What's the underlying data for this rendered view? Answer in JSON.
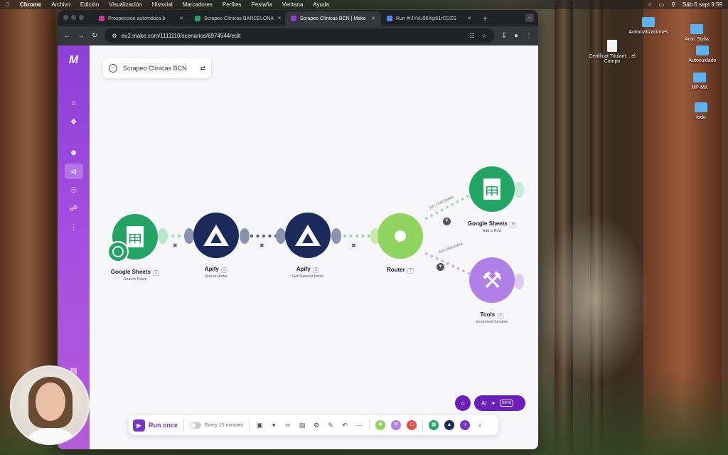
{
  "menubar": {
    "app": "Chrome",
    "items": [
      "Archivo",
      "Edición",
      "Visualización",
      "Historial",
      "Marcadores",
      "Perfiles",
      "Pestaña",
      "Ventana",
      "Ayuda"
    ],
    "datetime": "Sáb 6 sept 9:59"
  },
  "desktop": {
    "icons": [
      {
        "label": "Automatizaciones",
        "kind": "folder"
      },
      {
        "label": "Aran Stylia",
        "kind": "folder"
      },
      {
        "label": "Autocuidado",
        "kind": "folder"
      },
      {
        "label": "MP-MK",
        "kind": "folder"
      },
      {
        "label": "todo",
        "kind": "folder"
      },
      {
        "label": "Certificat Titularit... el Campo",
        "kind": "document"
      }
    ]
  },
  "browser": {
    "tabs": [
      {
        "label": "Prospección automática b",
        "color": "#c43a8e"
      },
      {
        "label": "Scrapeo Clínicas BARCELONA",
        "color": "#21a464"
      },
      {
        "label": "Scrapeo Clínicas BCN | Make",
        "color": "#8d3fd6",
        "active": true
      },
      {
        "label": "Run #rJYxU96Xgi61rCDZS",
        "color": "#4c8bf5"
      }
    ],
    "url": "eu2.make.com/1111110/scenarios/6974544/edit"
  },
  "scenario": {
    "title": "Scrapeo Clínicas BCN",
    "modules": [
      {
        "name": "Google Sheets",
        "num": "5",
        "sub": "Search Rows"
      },
      {
        "name": "Apify",
        "num": "2",
        "sub": "Run an Actor"
      },
      {
        "name": "Apify",
        "num": "3",
        "sub": "Get Dataset Items"
      },
      {
        "name": "Router",
        "num": "7",
        "sub": ""
      },
      {
        "name": "Google Sheets",
        "num": "6",
        "sub": "Add a Row"
      },
      {
        "name": "Tools",
        "num": "8",
        "sub": "Increment function"
      }
    ],
    "routes": [
      "1st | CON EMAIL",
      "2nd | SIN EMAIL"
    ]
  },
  "toolbar": {
    "run_label": "Run once",
    "schedule": "Every 15 minutes"
  },
  "ai": {
    "label": "AI",
    "beta": "BETA"
  },
  "colors": {
    "make_purple": "#7a32c9",
    "sheets_green": "#21a464",
    "apify_navy": "#1a2a5a",
    "router_green": "#8fd45f",
    "tools_purple": "#b07fe8"
  }
}
